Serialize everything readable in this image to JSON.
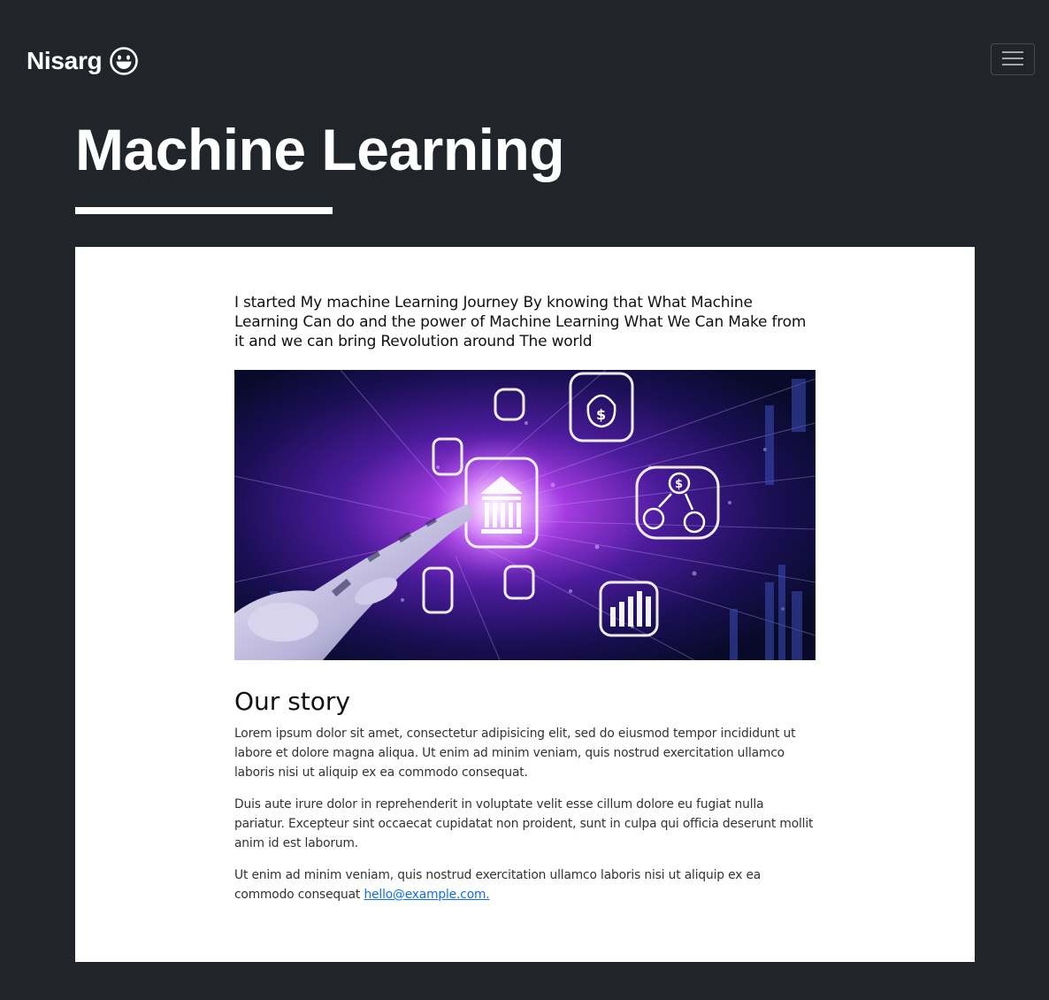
{
  "navbar": {
    "brand": "Nisarg",
    "brand_icon": "grin-face-icon",
    "toggler_icon": "hamburger-menu-icon"
  },
  "header": {
    "title": "Machine Learning"
  },
  "article": {
    "lead": "I started My machine Learning Journey By knowing that What Machine Learning Can do and the power of Machine Learning What We Can Make from it and we can bring Revolution around The world",
    "hero_image": "robot-hand-fintech-icons-image",
    "story_heading": "Our story",
    "paragraphs": [
      "Lorem ipsum dolor sit amet, consectetur adipisicing elit, sed do eiusmod tempor incididunt ut labore et dolore magna aliqua. Ut enim ad minim veniam, quis nostrud exercitation ullamco laboris nisi ut aliquip ex ea commodo consequat.",
      "Duis aute irure dolor in reprehenderit in voluptate velit esse cillum dolore eu fugiat nulla pariatur. Excepteur sint occaecat cupidatat non proident, sunt in culpa qui officia deserunt mollit anim id est laborum.",
      "Ut enim ad minim veniam, quis nostrud exercitation ullamco laboris nisi ut aliquip ex ea commodo consequat"
    ],
    "email_link": "hello@example.com."
  },
  "colors": {
    "background": "#212529",
    "card": "#ffffff",
    "link": "#0d6efd",
    "accent_purple": "#b14dff"
  }
}
